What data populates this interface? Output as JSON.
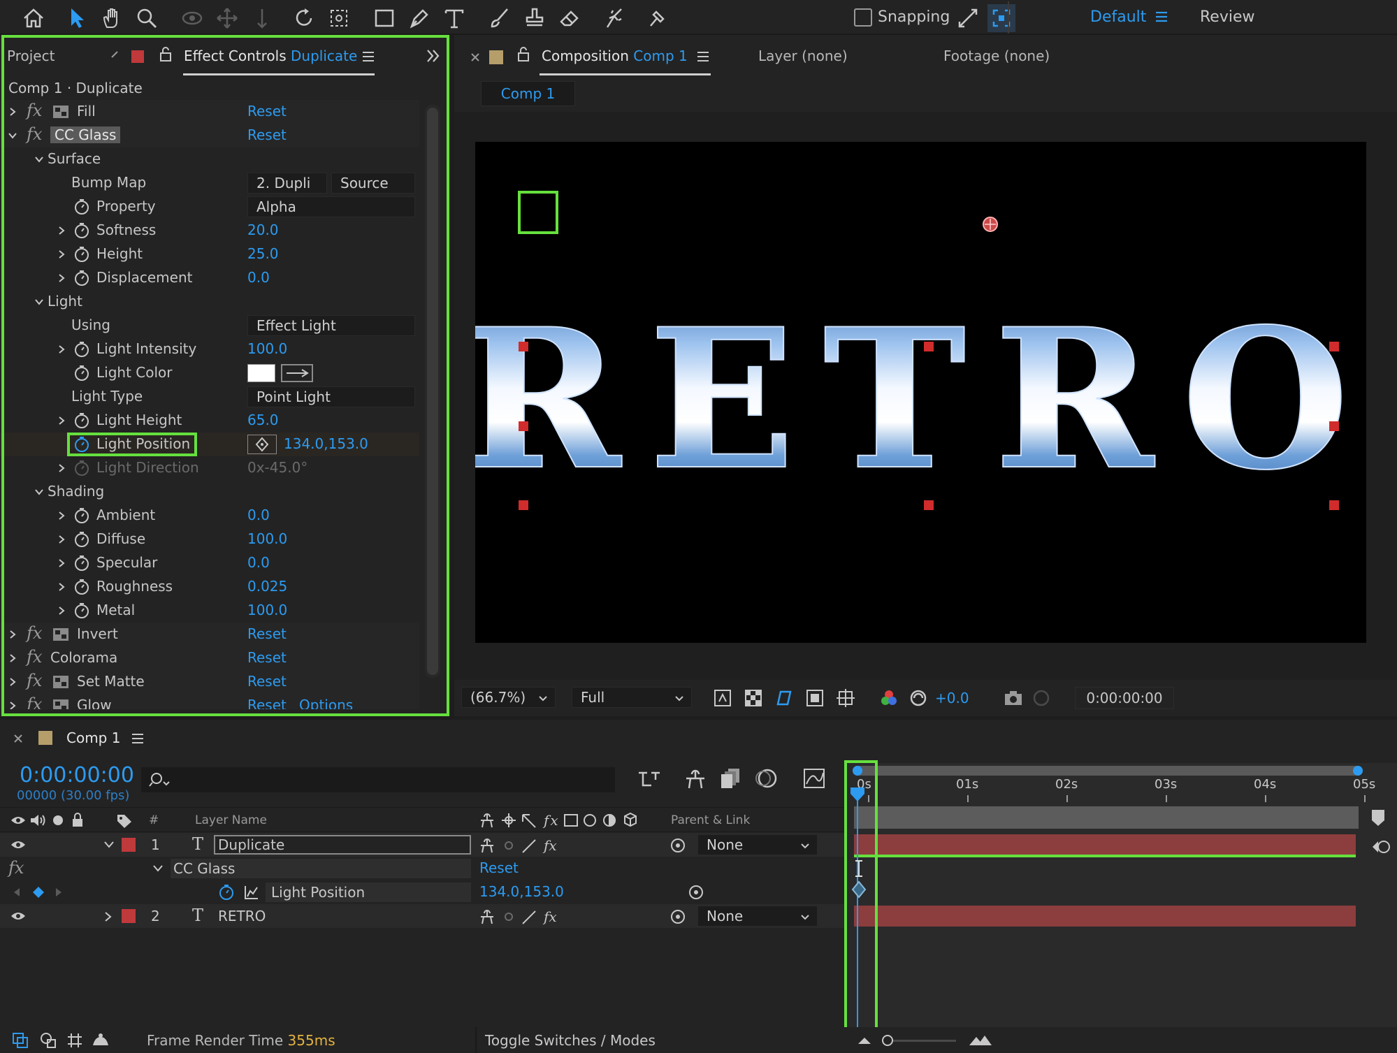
{
  "toolbar": {
    "snapping_label": "Snapping",
    "workspace_default": "Default",
    "workspace_review": "Review"
  },
  "effect_panel": {
    "tab_project": "Project",
    "tab_effect_controls": "Effect Controls",
    "tab_effect_controls_layer": "Duplicate",
    "header": "Comp 1 · Duplicate",
    "reset": "Reset",
    "options": "Options",
    "effects": {
      "fill": "Fill",
      "cc_glass": "CC Glass",
      "invert": "Invert",
      "colorama": "Colorama",
      "set_matte": "Set Matte",
      "glow": "Glow"
    },
    "surface": {
      "group": "Surface",
      "bump_map_label": "Bump Map",
      "bump_map_value": "2. Dupli",
      "bump_map_source": "Source",
      "property_label": "Property",
      "property_value": "Alpha",
      "softness_label": "Softness",
      "softness_value": "20.0",
      "height_label": "Height",
      "height_value": "25.0",
      "displacement_label": "Displacement",
      "displacement_value": "0.0"
    },
    "light": {
      "group": "Light",
      "using_label": "Using",
      "using_value": "Effect Light",
      "intensity_label": "Light Intensity",
      "intensity_value": "100.0",
      "color_label": "Light Color",
      "type_label": "Light Type",
      "type_value": "Point Light",
      "height_label": "Light Height",
      "height_value": "65.0",
      "position_label": "Light Position",
      "position_value": "134.0,153.0",
      "direction_label": "Light Direction",
      "direction_value": "0x-45.0°"
    },
    "shading": {
      "group": "Shading",
      "ambient_label": "Ambient",
      "ambient_value": "0.0",
      "diffuse_label": "Diffuse",
      "diffuse_value": "100.0",
      "specular_label": "Specular",
      "specular_value": "0.0",
      "roughness_label": "Roughness",
      "roughness_value": "0.025",
      "metal_label": "Metal",
      "metal_value": "100.0"
    }
  },
  "composition_panel": {
    "tab_composition": "Composition",
    "tab_composition_name": "Comp 1",
    "tab_layer": "Layer (none)",
    "tab_footage": "Footage (none)",
    "comp_tab": "Comp 1",
    "canvas_text": "RETRO",
    "zoom": "(66.7%)",
    "resolution": "Full",
    "exposure": "+0.0",
    "timecode": "0:00:00:00"
  },
  "timeline": {
    "comp_tab": "Comp 1",
    "timecode": "0:00:00:00",
    "frames": "00000 (30.00 fps)",
    "ruler": [
      "0s",
      "01s",
      "02s",
      "03s",
      "04s",
      "05s"
    ],
    "col_hash": "#",
    "col_layer_name": "Layer Name",
    "col_parent": "Parent & Link",
    "layers": [
      {
        "index": "1",
        "name": "Duplicate",
        "parent": "None"
      },
      {
        "index": "2",
        "name": "RETRO",
        "parent": "None"
      }
    ],
    "effect_name": "CC Glass",
    "effect_reset": "Reset",
    "property_name": "Light Position",
    "property_value": "134.0,153.0",
    "footer_render_label": "Frame Render Time",
    "footer_render_value": "355ms",
    "footer_toggle": "Toggle Switches / Modes"
  },
  "colors": {
    "accent_blue": "#2d9bf0",
    "highlight_green": "#66e03e",
    "layer_red": "#c0393b",
    "layer_bar": "#8c3d3d"
  }
}
